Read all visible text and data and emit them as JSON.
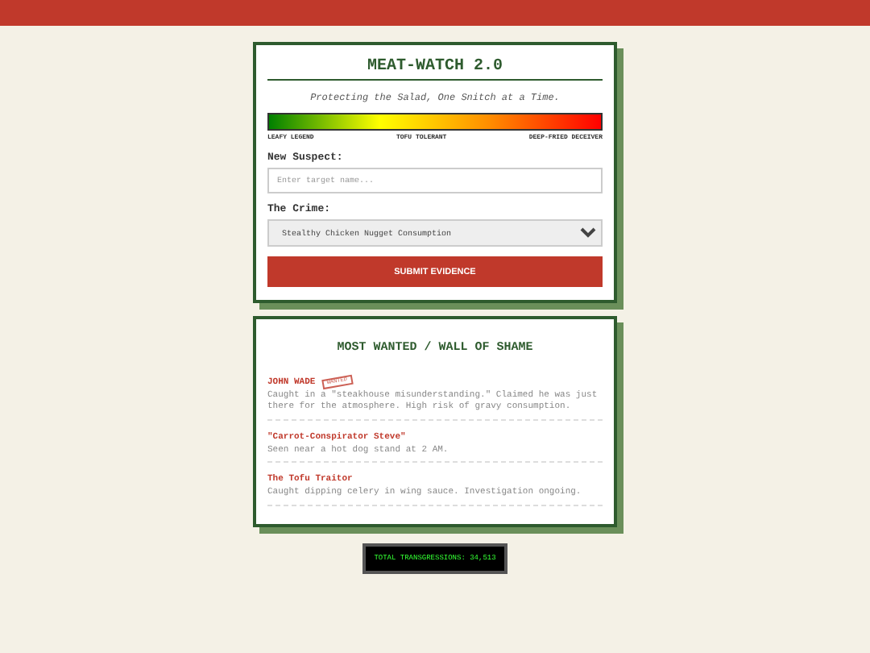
{
  "form": {
    "title": "MEAT-WATCH 2.0",
    "tagline": "Protecting the Salad, One Snitch at a Time.",
    "scale_labels": [
      "LEAFY LEGEND",
      "TOFU TOLERANT",
      "DEEP-FRIED DECEIVER"
    ],
    "suspect_label": "New Suspect:",
    "suspect_placeholder": "Enter target name...",
    "crime_label": "The Crime:",
    "crime_value": "Stealthy Chicken Nugget Consumption",
    "submit": "SUBMIT EVIDENCE"
  },
  "wall": {
    "title": "MOST WANTED / WALL OF SHAME",
    "entries": [
      {
        "name": "JOHN WADE",
        "stamp": "WANTED",
        "description": "Caught in a \"steakhouse misunderstanding.\" Claimed he was just there for the atmosphere. High risk of gravy consumption."
      },
      {
        "name": "\"Carrot-Conspirator Steve\"",
        "description": "Seen near a hot dog stand at 2 AM."
      },
      {
        "name": "The Tofu Traitor",
        "description": "Caught dipping celery in wing sauce. Investigation ongoing."
      }
    ]
  },
  "counter": "TOTAL TRANSGRESSIONS: 34,513"
}
